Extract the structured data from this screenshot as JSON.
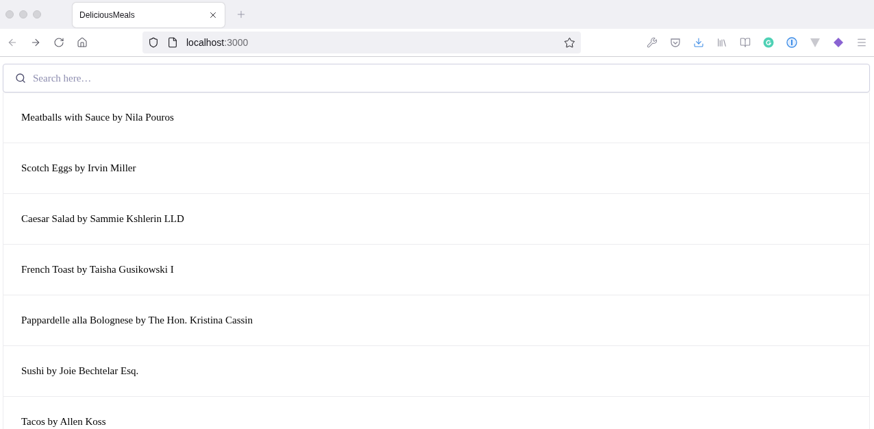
{
  "browser": {
    "tab": {
      "title": "DeliciousMeals",
      "selected": true
    },
    "url_host": "localhost",
    "url_port": ":3000"
  },
  "search": {
    "placeholder": "Search here…"
  },
  "recipes": [
    {
      "label": "Meatballs with Sauce by Nila Pouros"
    },
    {
      "label": "Scotch Eggs by Irvin Miller"
    },
    {
      "label": "Caesar Salad by Sammie Kshlerin LLD"
    },
    {
      "label": "French Toast by Taisha Gusikowski I"
    },
    {
      "label": "Pappardelle alla Bolognese by The Hon. Kristina Cassin"
    },
    {
      "label": "Sushi by Joie Bechtelar Esq."
    },
    {
      "label": "Tacos by Allen Koss"
    }
  ]
}
